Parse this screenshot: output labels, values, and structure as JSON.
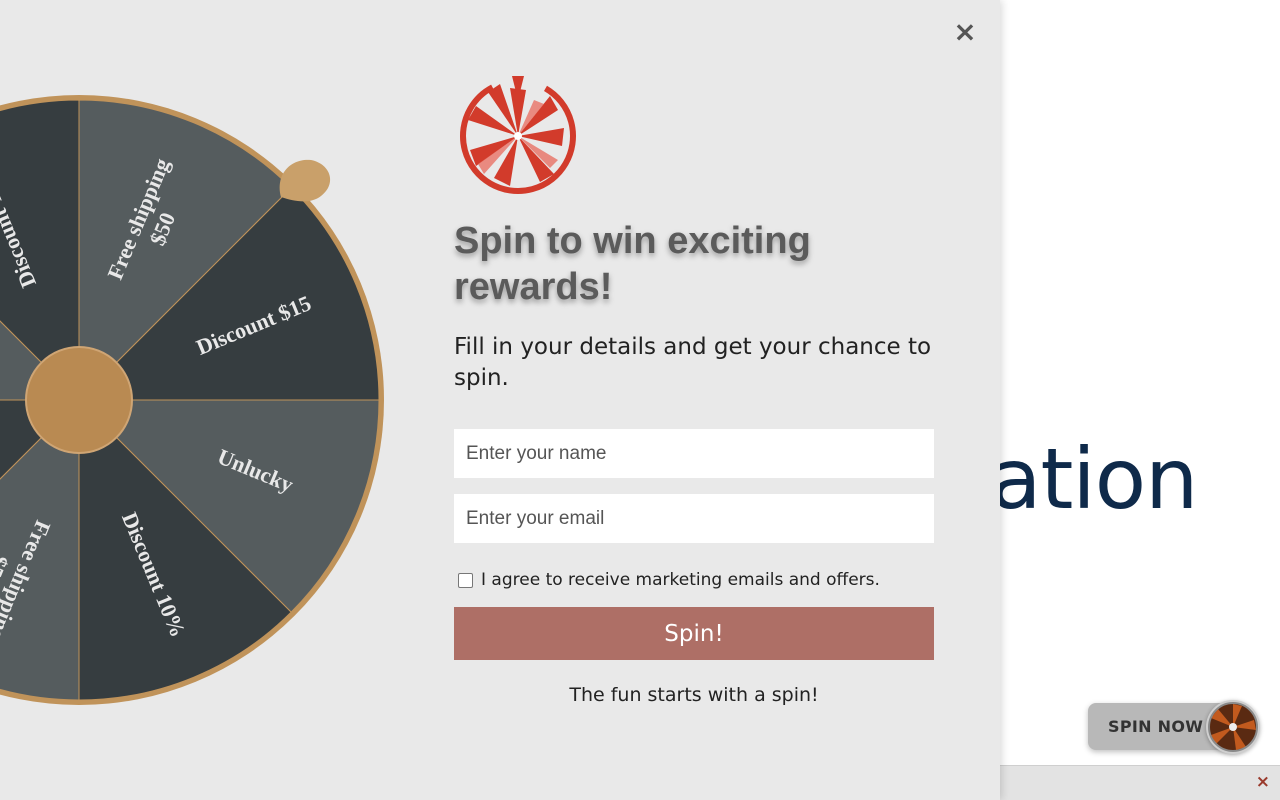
{
  "background": {
    "heading_fragment": "ation"
  },
  "modal": {
    "close_icon": "close-icon",
    "close_label": "×",
    "logo_icon": "spin-wheel-logo-icon",
    "headline": "Spin to win exciting rewards!",
    "subtext": "Fill in your details and get your chance to spin.",
    "name_placeholder": "Enter your name",
    "email_placeholder": "Enter your email",
    "consent_label": "I agree to receive marketing emails and offers.",
    "consent_checked": false,
    "spin_button_label": "Spin!",
    "tagline": "The fun starts with a spin!"
  },
  "wheel": {
    "colors": {
      "dark": "#363d40",
      "light": "#555c5e",
      "rim": "#c0935a",
      "hub": "#b98a52",
      "pointer": "#c9a06a",
      "label": "#e8e8e8"
    },
    "segments": [
      {
        "label": "Unlucky",
        "shade": "light"
      },
      {
        "label": "Discount 10%",
        "shade": "dark"
      },
      {
        "label": "Free shipping $50",
        "shade": "light"
      },
      {
        "label": "Discount $15",
        "shade": "dark"
      },
      {
        "label": "Unlucky",
        "shade": "light"
      },
      {
        "label": "Discount 10%",
        "shade": "dark"
      },
      {
        "label": "Free shipping $50",
        "shade": "light"
      },
      {
        "label": "Discount $15",
        "shade": "dark"
      }
    ]
  },
  "floating": {
    "spin_now_label": "SPIN NOW",
    "spin_now_icon": "mini-wheel-icon"
  },
  "bottom_bar": {
    "close_label": "×",
    "close_icon": "close-icon"
  },
  "theme": {
    "accent": "#ae6f66",
    "logo_red": "#d23b2b",
    "heading_blue": "#0f2a4a"
  }
}
